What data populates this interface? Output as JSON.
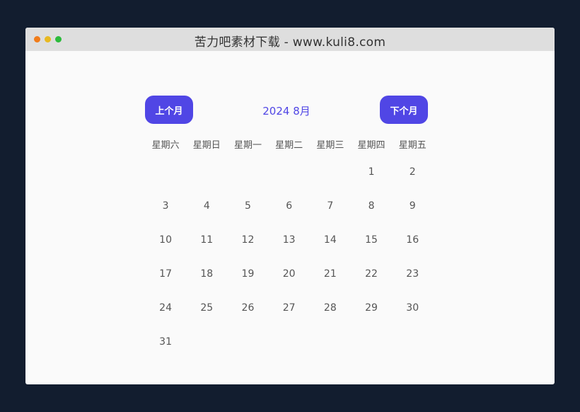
{
  "window": {
    "title": "苦力吧素材下载 - www.kuli8.com",
    "traffic_lights": [
      "#f07c1a",
      "#e8b922",
      "#2cbb3c"
    ]
  },
  "calendar": {
    "prev_label": "上个月",
    "next_label": "下个月",
    "month_label": "2024 8月",
    "accent_color": "#5046e5",
    "weekdays": [
      "星期六",
      "星期日",
      "星期一",
      "星期二",
      "星期三",
      "星期四",
      "星期五"
    ],
    "leading_blanks": 5,
    "days": [
      "1",
      "2",
      "3",
      "4",
      "5",
      "6",
      "7",
      "8",
      "9",
      "10",
      "11",
      "12",
      "13",
      "14",
      "15",
      "16",
      "17",
      "18",
      "19",
      "20",
      "21",
      "22",
      "23",
      "24",
      "25",
      "26",
      "27",
      "28",
      "29",
      "30",
      "31"
    ]
  }
}
